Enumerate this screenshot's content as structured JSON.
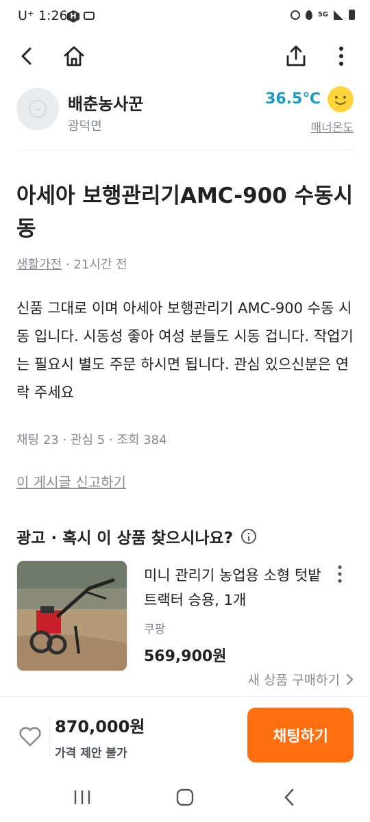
{
  "status_bar": {
    "carrier": "U⁺ 1:26",
    "h_badge": "H",
    "network": "5G"
  },
  "seller": {
    "name": "배춘농사꾼",
    "location": "광덕면",
    "temperature": "36.5℃",
    "manner_label": "매너온도"
  },
  "post": {
    "title": "아세아 보행관리기AMC-900 수동시동",
    "category": "생활가전",
    "time": " · 21시간 전",
    "description": "신품 그대로 이며 아세아 보행관리기 AMC-900 수동 시동 입니다. 시동성 좋아 여성 분들도 시동 겁니다. 작업기는 필요시 별도 주문 하시면 됩니다. 관심 있으신분은 연락 주세요",
    "stats": "채팅 23 · 관심 5 · 조회 384",
    "report": "이 게시글 신고하기"
  },
  "ad": {
    "heading": "광고 · 혹시 이 상품 찾으시나요?",
    "product_name": "미니 관리기 농업용 소형 텃밭 트랙터 승용, 1개",
    "shop": "쿠팡",
    "price": "569,900원",
    "buy_label": "새 상품 구매하기"
  },
  "bottom": {
    "price": "870,000원",
    "negotiation": "가격 제안 불가",
    "chat_button": "채팅하기"
  },
  "colors": {
    "accent": "#ff6f0f",
    "temperature": "#1a9bc9",
    "muted": "#868b94"
  }
}
